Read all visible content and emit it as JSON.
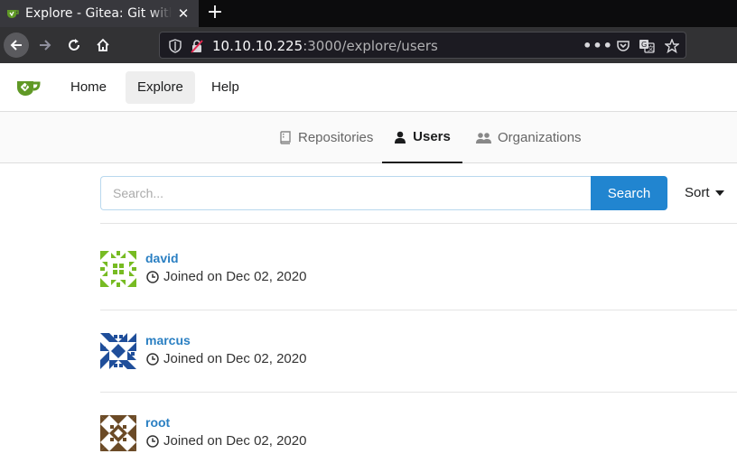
{
  "browser": {
    "tab_title": "Explore - Gitea: Git with a cup of tea",
    "url_host": "10.10.10.225",
    "url_path": ":3000/explore/users"
  },
  "header": {
    "nav": [
      {
        "label": "Home"
      },
      {
        "label": "Explore"
      },
      {
        "label": "Help"
      }
    ]
  },
  "explore_tabs": [
    {
      "label": "Repositories",
      "icon": "repo-icon"
    },
    {
      "label": "Users",
      "icon": "person-icon"
    },
    {
      "label": "Organizations",
      "icon": "organization-icon"
    }
  ],
  "search": {
    "placeholder": "Search...",
    "button_label": "Search",
    "sort_label": "Sort"
  },
  "users": [
    {
      "name": "david",
      "joined": "Joined on Dec 02, 2020",
      "avatar_color": "#77bb22"
    },
    {
      "name": "marcus",
      "joined": "Joined on Dec 02, 2020",
      "avatar_color": "#1f4e9a"
    },
    {
      "name": "root",
      "joined": "Joined on Dec 02, 2020",
      "avatar_color": "#6b4a26"
    }
  ],
  "colors": {
    "gitea_green": "#609926",
    "link_blue": "#2a7fc2",
    "primary_button": "#2185d0"
  }
}
